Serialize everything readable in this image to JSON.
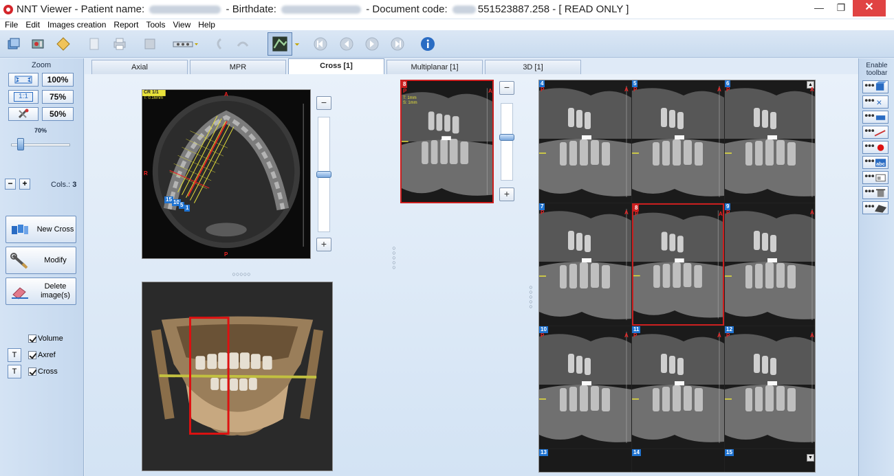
{
  "window": {
    "title_prefix": "NNT Viewer - Patient name: ",
    "birthdate_label": " - Birthdate: ",
    "doc_label": " - Document code: ",
    "doc_code_tail": "551523887.258",
    "mode": " - [ READ ONLY ]",
    "minimize": "—",
    "restore": "❐",
    "close": "✕"
  },
  "menu": [
    "File",
    "Edit",
    "Images creation",
    "Report",
    "Tools",
    "View",
    "Help"
  ],
  "left": {
    "zoom_label": "Zoom",
    "zoom_100": "100%",
    "zoom_75": "75%",
    "zoom_50": "50%",
    "fit_ratio_label": "1:1",
    "slider_value": "70%",
    "cols_label": "Cols.:",
    "cols_value": "3",
    "minus": "−",
    "plus": "+",
    "new_cross": "New Cross",
    "modify": "Modify",
    "delete_images": "Delete image(s)",
    "chk_volume": "Volume",
    "chk_axref": "Axref",
    "chk_cross": "Cross",
    "t": "T"
  },
  "tabs": [
    {
      "label": "Axial",
      "active": false
    },
    {
      "label": "MPR",
      "active": false
    },
    {
      "label": "Cross [1]",
      "active": true
    },
    {
      "label": "Multiplanar [1]",
      "active": false
    },
    {
      "label": "3D [1]",
      "active": false
    }
  ],
  "axial": {
    "cr_label": "CR 1/1",
    "thickness": "T: 0.16mm",
    "orient_top": "A",
    "orient_left": "R",
    "orient_bottom": "P",
    "marker_labels": [
      "15",
      "10",
      "5",
      "1"
    ]
  },
  "preview": {
    "slice": "8",
    "p": "P",
    "a": "A",
    "info_t": "T: 1mm",
    "info_s": "S: 1mm"
  },
  "grid": {
    "cells": [
      {
        "num": "4"
      },
      {
        "num": "5"
      },
      {
        "num": "6"
      },
      {
        "num": "7"
      },
      {
        "num": "8",
        "selected": true
      },
      {
        "num": "9"
      },
      {
        "num": "10"
      },
      {
        "num": "11"
      },
      {
        "num": "12"
      }
    ],
    "bottom_nums": [
      "13",
      "14",
      "15"
    ],
    "p": "P",
    "a": "A"
  },
  "right": {
    "label": "Enable toolbar",
    "buttons": [
      "cube-icon",
      "ruler-x-icon",
      "ruler-m-icon",
      "line-icon",
      "point-icon",
      "abc-icon",
      "window-icon",
      "trash-icon",
      "print-icon"
    ]
  },
  "colors": {
    "accent": "#1f73d1",
    "selection": "#cc1f1f",
    "annotation_yellow": "#e8e23a"
  }
}
